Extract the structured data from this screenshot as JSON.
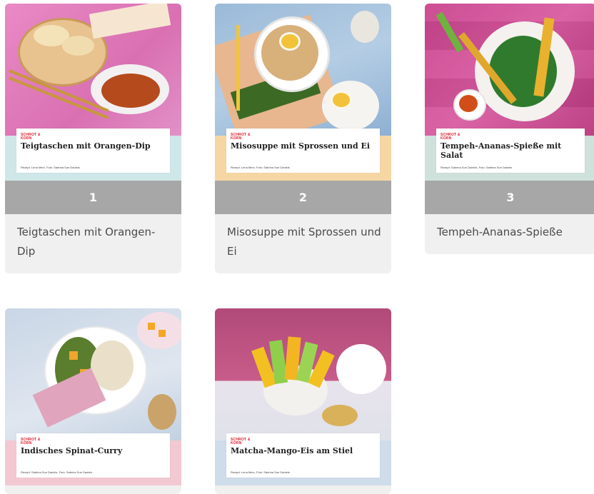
{
  "brand": "SCHROT & KORN",
  "cards": [
    {
      "title": "Teigtaschen mit Orangen-Dip",
      "credit": "Rezept: Lena Merz, Foto: Sabrina Sue Daniels",
      "number": "1",
      "caption": "Teigtaschen mit Orangen-Dip",
      "band_color": "#cfe7e9"
    },
    {
      "title": "Misosuppe mit Sprossen und Ei",
      "credit": "Rezept: Lena Merz, Foto: Sabrina Sue Daniels",
      "number": "2",
      "caption": "Misosuppe mit Sprossen und Ei",
      "band_color": "#f6d7a4"
    },
    {
      "title": "Tempeh-Ananas-Spieße mit Salat",
      "credit": "Rezept: Sabrina Sue Daniels, Foto: Sabrina Sue Daniels",
      "number": "3",
      "caption": "Tempeh-Ananas-Spieße",
      "band_color": "#cfe1db"
    },
    {
      "title": "Indisches Spinat-Curry",
      "credit": "Rezept: Sabrina Sue Daniels, Foto: Sabrina Sue Daniels",
      "band_color": "#f2c9d3"
    },
    {
      "title": "Matcha-Mango-Eis am Stiel",
      "credit": "Rezept: Lena Merz, Foto: Sabrina Sue Daniels",
      "band_color": "#cfdcea"
    }
  ]
}
